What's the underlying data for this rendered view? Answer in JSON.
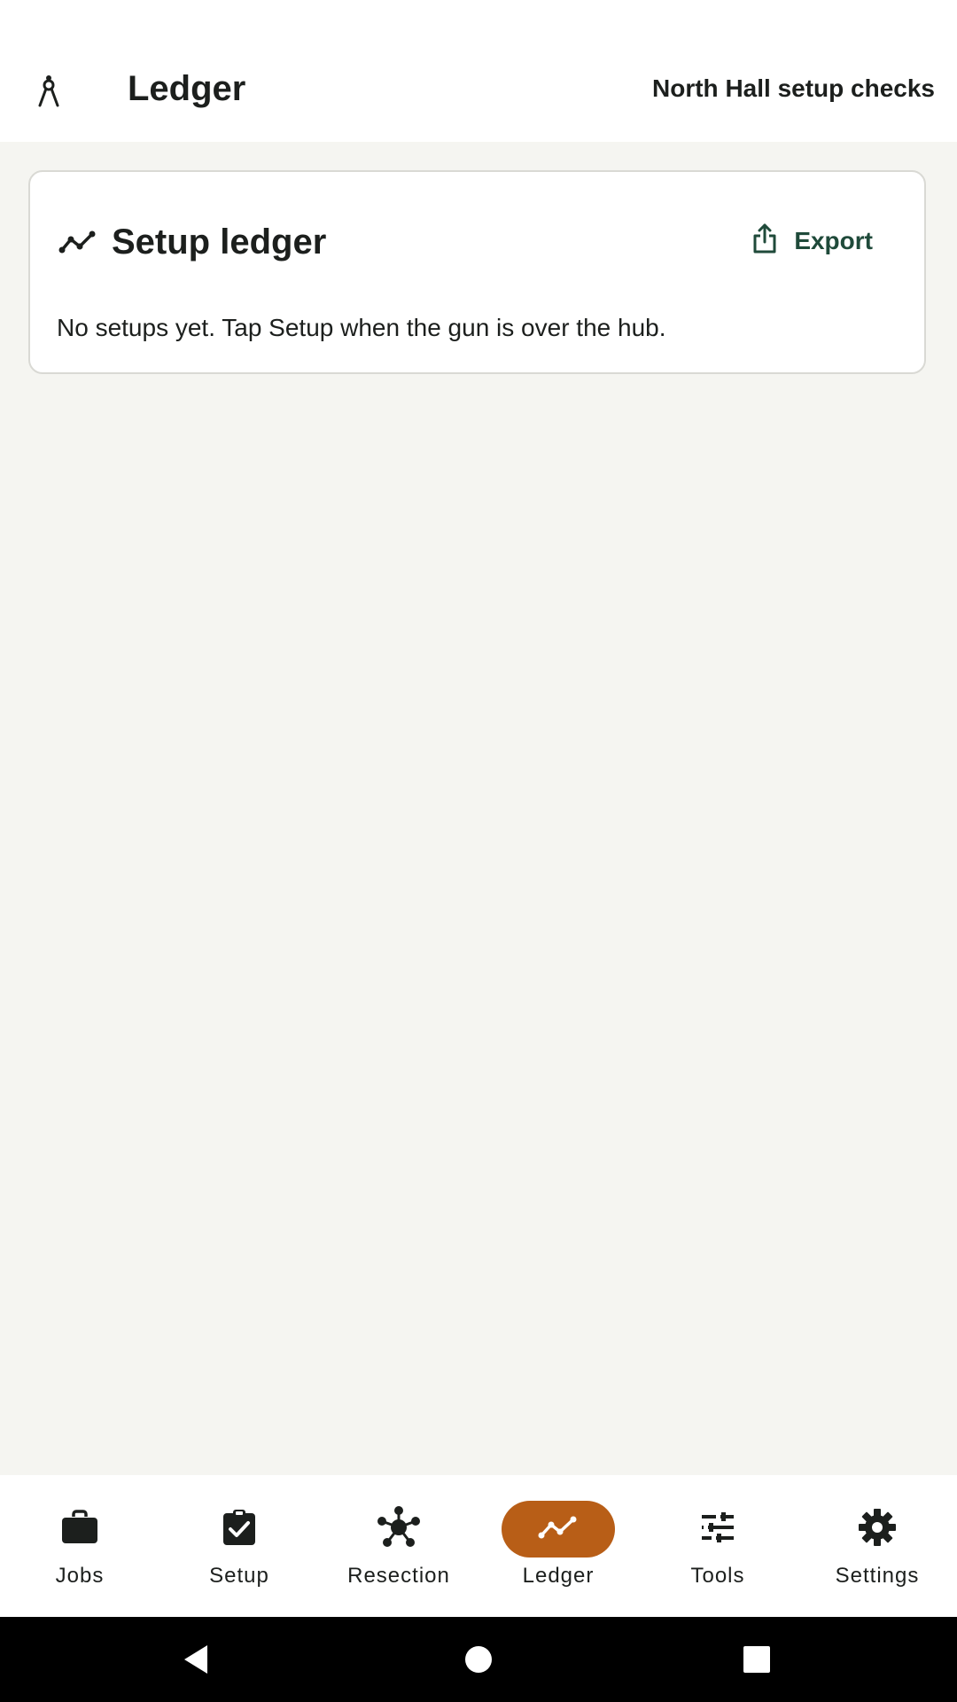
{
  "app_bar": {
    "icon": "compass-icon",
    "title": "Ledger",
    "subtitle": "North Hall setup checks"
  },
  "card": {
    "icon": "trend-line-icon",
    "title": "Setup ledger",
    "export_label": "Export",
    "export_icon": "share-upload-icon",
    "message": "No setups yet. Tap Setup when the gun is over the hub."
  },
  "bottom_nav": {
    "items": [
      {
        "label": "Jobs",
        "icon": "briefcase-icon",
        "active": false
      },
      {
        "label": "Setup",
        "icon": "clipboard-check-icon",
        "active": false
      },
      {
        "label": "Resection",
        "icon": "hub-network-icon",
        "active": false
      },
      {
        "label": "Ledger",
        "icon": "trend-line-icon",
        "active": true
      },
      {
        "label": "Tools",
        "icon": "sliders-icon",
        "active": false
      },
      {
        "label": "Settings",
        "icon": "gear-icon",
        "active": false
      }
    ],
    "active_color": "#b85e17"
  },
  "system_nav": {
    "back_icon": "back-triangle-icon",
    "home_icon": "home-circle-icon",
    "recents_icon": "recents-square-icon"
  },
  "colors": {
    "background": "#f5f5f1",
    "accent": "#b85e17",
    "export_text": "#1f4a3a",
    "text": "#1c1f1d"
  }
}
